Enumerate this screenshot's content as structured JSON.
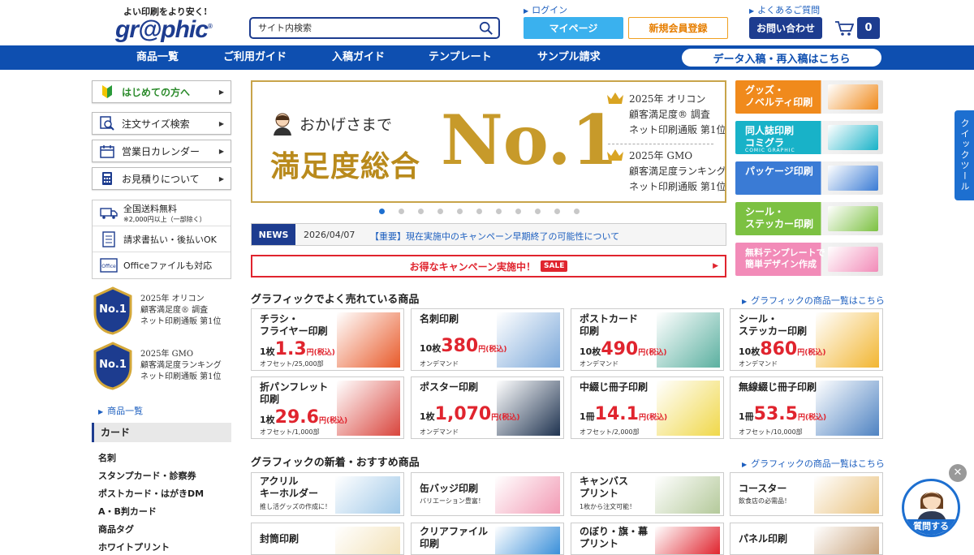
{
  "header": {
    "tagline": "よい印刷をより安く!",
    "logo": "gr@phic",
    "logo_mark": "®",
    "search_placeholder": "サイト内検索",
    "login_link": "ログイン",
    "faq_link": "よくあるご質問",
    "mypage": "マイページ",
    "register": "新規会員登録",
    "contact": "お問い合わせ",
    "cart_count": "0"
  },
  "nav": {
    "items": [
      "商品一覧",
      "ご利用ガイド",
      "入稿ガイド",
      "テンプレート",
      "サンプル請求"
    ],
    "data_button": "データ入稿・再入稿はこちら"
  },
  "left": {
    "buttons": [
      "はじめての方へ",
      "注文サイズ検索",
      "営業日カレンダー",
      "お見積りについて"
    ],
    "info": {
      "shipping_title": "全国送料無料",
      "shipping_note": "※2,000円以上（一部除く）",
      "invoice": "請求書払い・後払いOK",
      "office": "Officeファイルも対応"
    },
    "badges": [
      {
        "emblem": "No.1",
        "lines": [
          "2025年 オリコン",
          "顧客満足度® 調査",
          "ネット印刷通販 第1位"
        ]
      },
      {
        "emblem": "No.1",
        "lines": [
          "2025年 GMO",
          "顧客満足度ランキング",
          "ネット印刷通販 第1位"
        ]
      }
    ],
    "category_link": "商品一覧",
    "category_head": "カード",
    "category_items": [
      "名刺",
      "スタンプカード・診察券",
      "ポストカード・はがきDM",
      "A・B判カード",
      "商品タグ",
      "ホワイトプリント"
    ]
  },
  "banner": {
    "okage": "おかげさまで",
    "manzoku": "満足度総合",
    "no1": "No.1",
    "right_top": [
      "2025年 オリコン",
      "顧客満足度® 調査",
      "ネット印刷通販 第1位"
    ],
    "right_bottom": [
      "2025年 GMO",
      "顧客満足度ランキング",
      "ネット印刷通販 第1位"
    ]
  },
  "news": {
    "tag": "NEWS",
    "date": "2026/04/07",
    "text": "【重要】現在実施中のキャンペーン早期終了の可能性について"
  },
  "campaign": {
    "text": "お得なキャンペーン実施中！",
    "badge": "SALE"
  },
  "popular": {
    "title": "グラフィックでよく売れている商品",
    "link": "グラフィックの商品一覧はこちら",
    "cards": [
      {
        "name": "チラシ・\nフライヤー印刷",
        "qty": "1枚",
        "price": "1.3",
        "unit": "円(税込)",
        "sub": "オフセット/25,000部",
        "img_color": "#e85a2a"
      },
      {
        "name": "名刺印刷",
        "qty": "10枚",
        "price": "380",
        "unit": "円(税込)",
        "sub": "オンデマンド",
        "img_color": "#7aa7d9"
      },
      {
        "name": "ポストカード\n印刷",
        "qty": "10枚",
        "price": "490",
        "unit": "円(税込)",
        "sub": "オンデマンド",
        "img_color": "#5bb0a0"
      },
      {
        "name": "シール・\nステッカー印刷",
        "qty": "10枚",
        "price": "860",
        "unit": "円(税込)",
        "sub": "オンデマンド",
        "img_color": "#f2b632"
      },
      {
        "name": "折パンフレット\n印刷",
        "qty": "1枚",
        "price": "29.6",
        "unit": "円(税込)",
        "sub": "オフセット/1,000部",
        "img_color": "#d9453d"
      },
      {
        "name": "ポスター印刷",
        "qty": "1枚",
        "price": "1,070",
        "unit": "円(税込)",
        "sub": "オンデマンド",
        "img_color": "#1f3350"
      },
      {
        "name": "中綴じ冊子印刷",
        "qty": "1冊",
        "price": "14.1",
        "unit": "円(税込)",
        "sub": "オフセット/2,000部",
        "img_color": "#f0d84a"
      },
      {
        "name": "無線綴じ冊子印刷",
        "qty": "1冊",
        "price": "53.5",
        "unit": "円(税込)",
        "sub": "オフセット/10,000部",
        "img_color": "#4f83c2"
      }
    ]
  },
  "newitems": {
    "title": "グラフィックの新着・おすすめ商品",
    "link": "グラフィックの商品一覧はこちら",
    "cards": [
      {
        "name": "アクリル\nキーホルダー",
        "sub": "推し活グッズの作成に！",
        "img_color": "#9fc8e8"
      },
      {
        "name": "缶バッジ印刷",
        "sub": "バリエーション豊富！",
        "img_color": "#f29ab4"
      },
      {
        "name": "キャンバス\nプリント",
        "sub": "1枚から注文可能！",
        "img_color": "#b4c99a"
      },
      {
        "name": "コースター",
        "sub": "飲食店の必需品！",
        "img_color": "#e9c07a"
      },
      {
        "name": "封筒印刷",
        "sub": "",
        "img_color": "#f3e2b8"
      },
      {
        "name": "クリアファイル\n印刷",
        "sub": "",
        "img_color": "#3a8fd9"
      },
      {
        "name": "のぼり・旗・幕\nプリント",
        "sub": "",
        "img_color": "#e0242e"
      },
      {
        "name": "パネル印刷",
        "sub": "",
        "img_color": "#c9a27a"
      }
    ]
  },
  "right": {
    "banners": [
      {
        "text": "グッズ・\nノベルティ印刷",
        "color": "#f08a1c"
      },
      {
        "text": "同人誌印刷\nコミグラ",
        "sub": "COMIC GRAPHIC",
        "color": "#18b2c8"
      },
      {
        "text": "パッケージ印刷",
        "color": "#3a7bd5"
      },
      {
        "text": "シール・\nステッカー印刷",
        "color": "#7cc142"
      },
      {
        "text": "無料テンプレートで\n簡単デザイン作成",
        "color": "#f28bb8"
      }
    ]
  },
  "quick_tool": "クイックツール",
  "ask_button": "質問する",
  "close_glyph": "✕",
  "glyphs": {
    "arrow": "▶",
    "small_arrow": "▸"
  }
}
